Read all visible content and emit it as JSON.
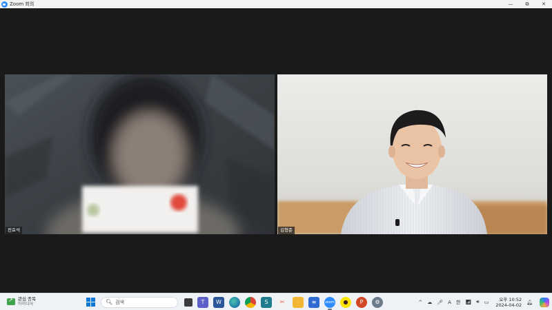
{
  "window": {
    "title": "Zoom 회의",
    "minimize": "—",
    "maximize": "⧉",
    "close": "✕"
  },
  "participants": [
    {
      "name": "전효석"
    },
    {
      "name": "김형준"
    }
  ],
  "taskbar": {
    "widget": {
      "title": "관심 종목",
      "subtitle": "아이디어"
    },
    "search": {
      "placeholder": "검색"
    },
    "tray": {
      "caret": "^",
      "ime_a": "A",
      "ime_lang": "한"
    },
    "clock": {
      "time": "오후 10:52",
      "date": "2024-04-02"
    }
  },
  "colors": {
    "zoom_blue": "#2d8cff",
    "stage": "#1a1a1a",
    "taskbar": "#eef1f6"
  }
}
